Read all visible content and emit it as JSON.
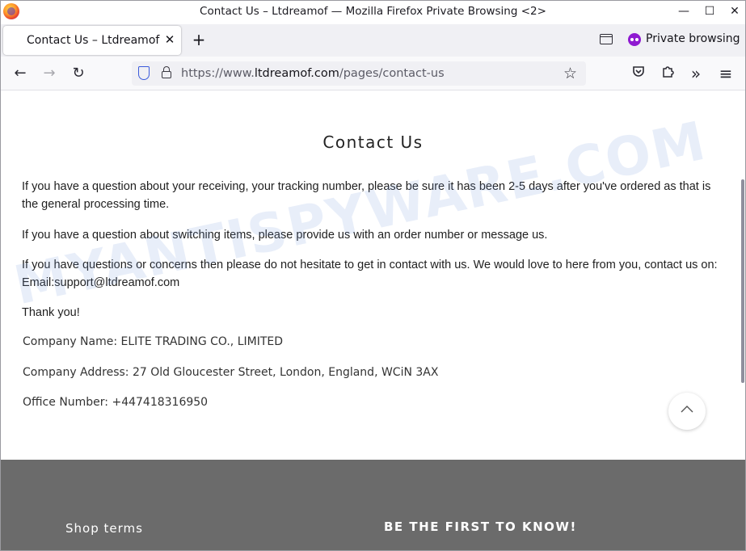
{
  "window": {
    "title": "Contact Us – Ltdreamof — Mozilla Firefox Private Browsing <2>",
    "minimize_glyph": "—",
    "maximize_glyph": "☐",
    "close_glyph": "✕"
  },
  "tabs": [
    {
      "label": "Contact Us – Ltdreamof",
      "active": true
    }
  ],
  "tabstrip": {
    "new_tab_glyph": "+",
    "tab_close_glyph": "✕",
    "private_label": "Private browsing"
  },
  "navbar": {
    "url_prefix": "https://www.",
    "url_host": "ltdreamof.com",
    "url_path": "/pages/contact-us",
    "back_glyph": "←",
    "forward_glyph": "→",
    "reload_glyph": "↻",
    "bookmark_glyph": "☆",
    "overflow_glyph": "»",
    "menu_glyph": "≡"
  },
  "icons": [
    "firefox-logo",
    "tab-list-icon",
    "private-browsing-icon",
    "back-icon",
    "forward-icon",
    "reload-icon",
    "shield-icon",
    "lock-icon",
    "bookmark-star-icon",
    "pocket-icon",
    "extensions-icon",
    "overflow-icon",
    "menu-icon",
    "scroll-to-top-icon"
  ],
  "page": {
    "heading": "Contact Us",
    "paragraphs": [
      "If you have a question about your receiving, your tracking number, please be sure it has been 2-5 days after you've ordered as that is the general processing time.",
      "If you have a question about switching items, please provide us with an order number or message us.",
      "If you have questions or concerns then please do not hesitate to get in contact with us. We would love to here from you, contact us on: Email:support@ltdreamof.com",
      "Thank you!"
    ],
    "company_name": "Company Name: ELITE TRADING CO., LIMITED",
    "company_address": "Company Address: 27 Old Gloucester Street, London, England, WCiN 3AX",
    "office_number": "Office Number:  +447418316950",
    "watermark": "MYANTISPYWARE.COM"
  },
  "footer": {
    "left_heading": "Shop terms",
    "right_heading": "BE THE FIRST TO KNOW!"
  },
  "colors": {
    "tabstrip_bg": "#f0f0f4",
    "private_purple": "#8f1ad1",
    "footer_bg": "#6b6b6b"
  }
}
